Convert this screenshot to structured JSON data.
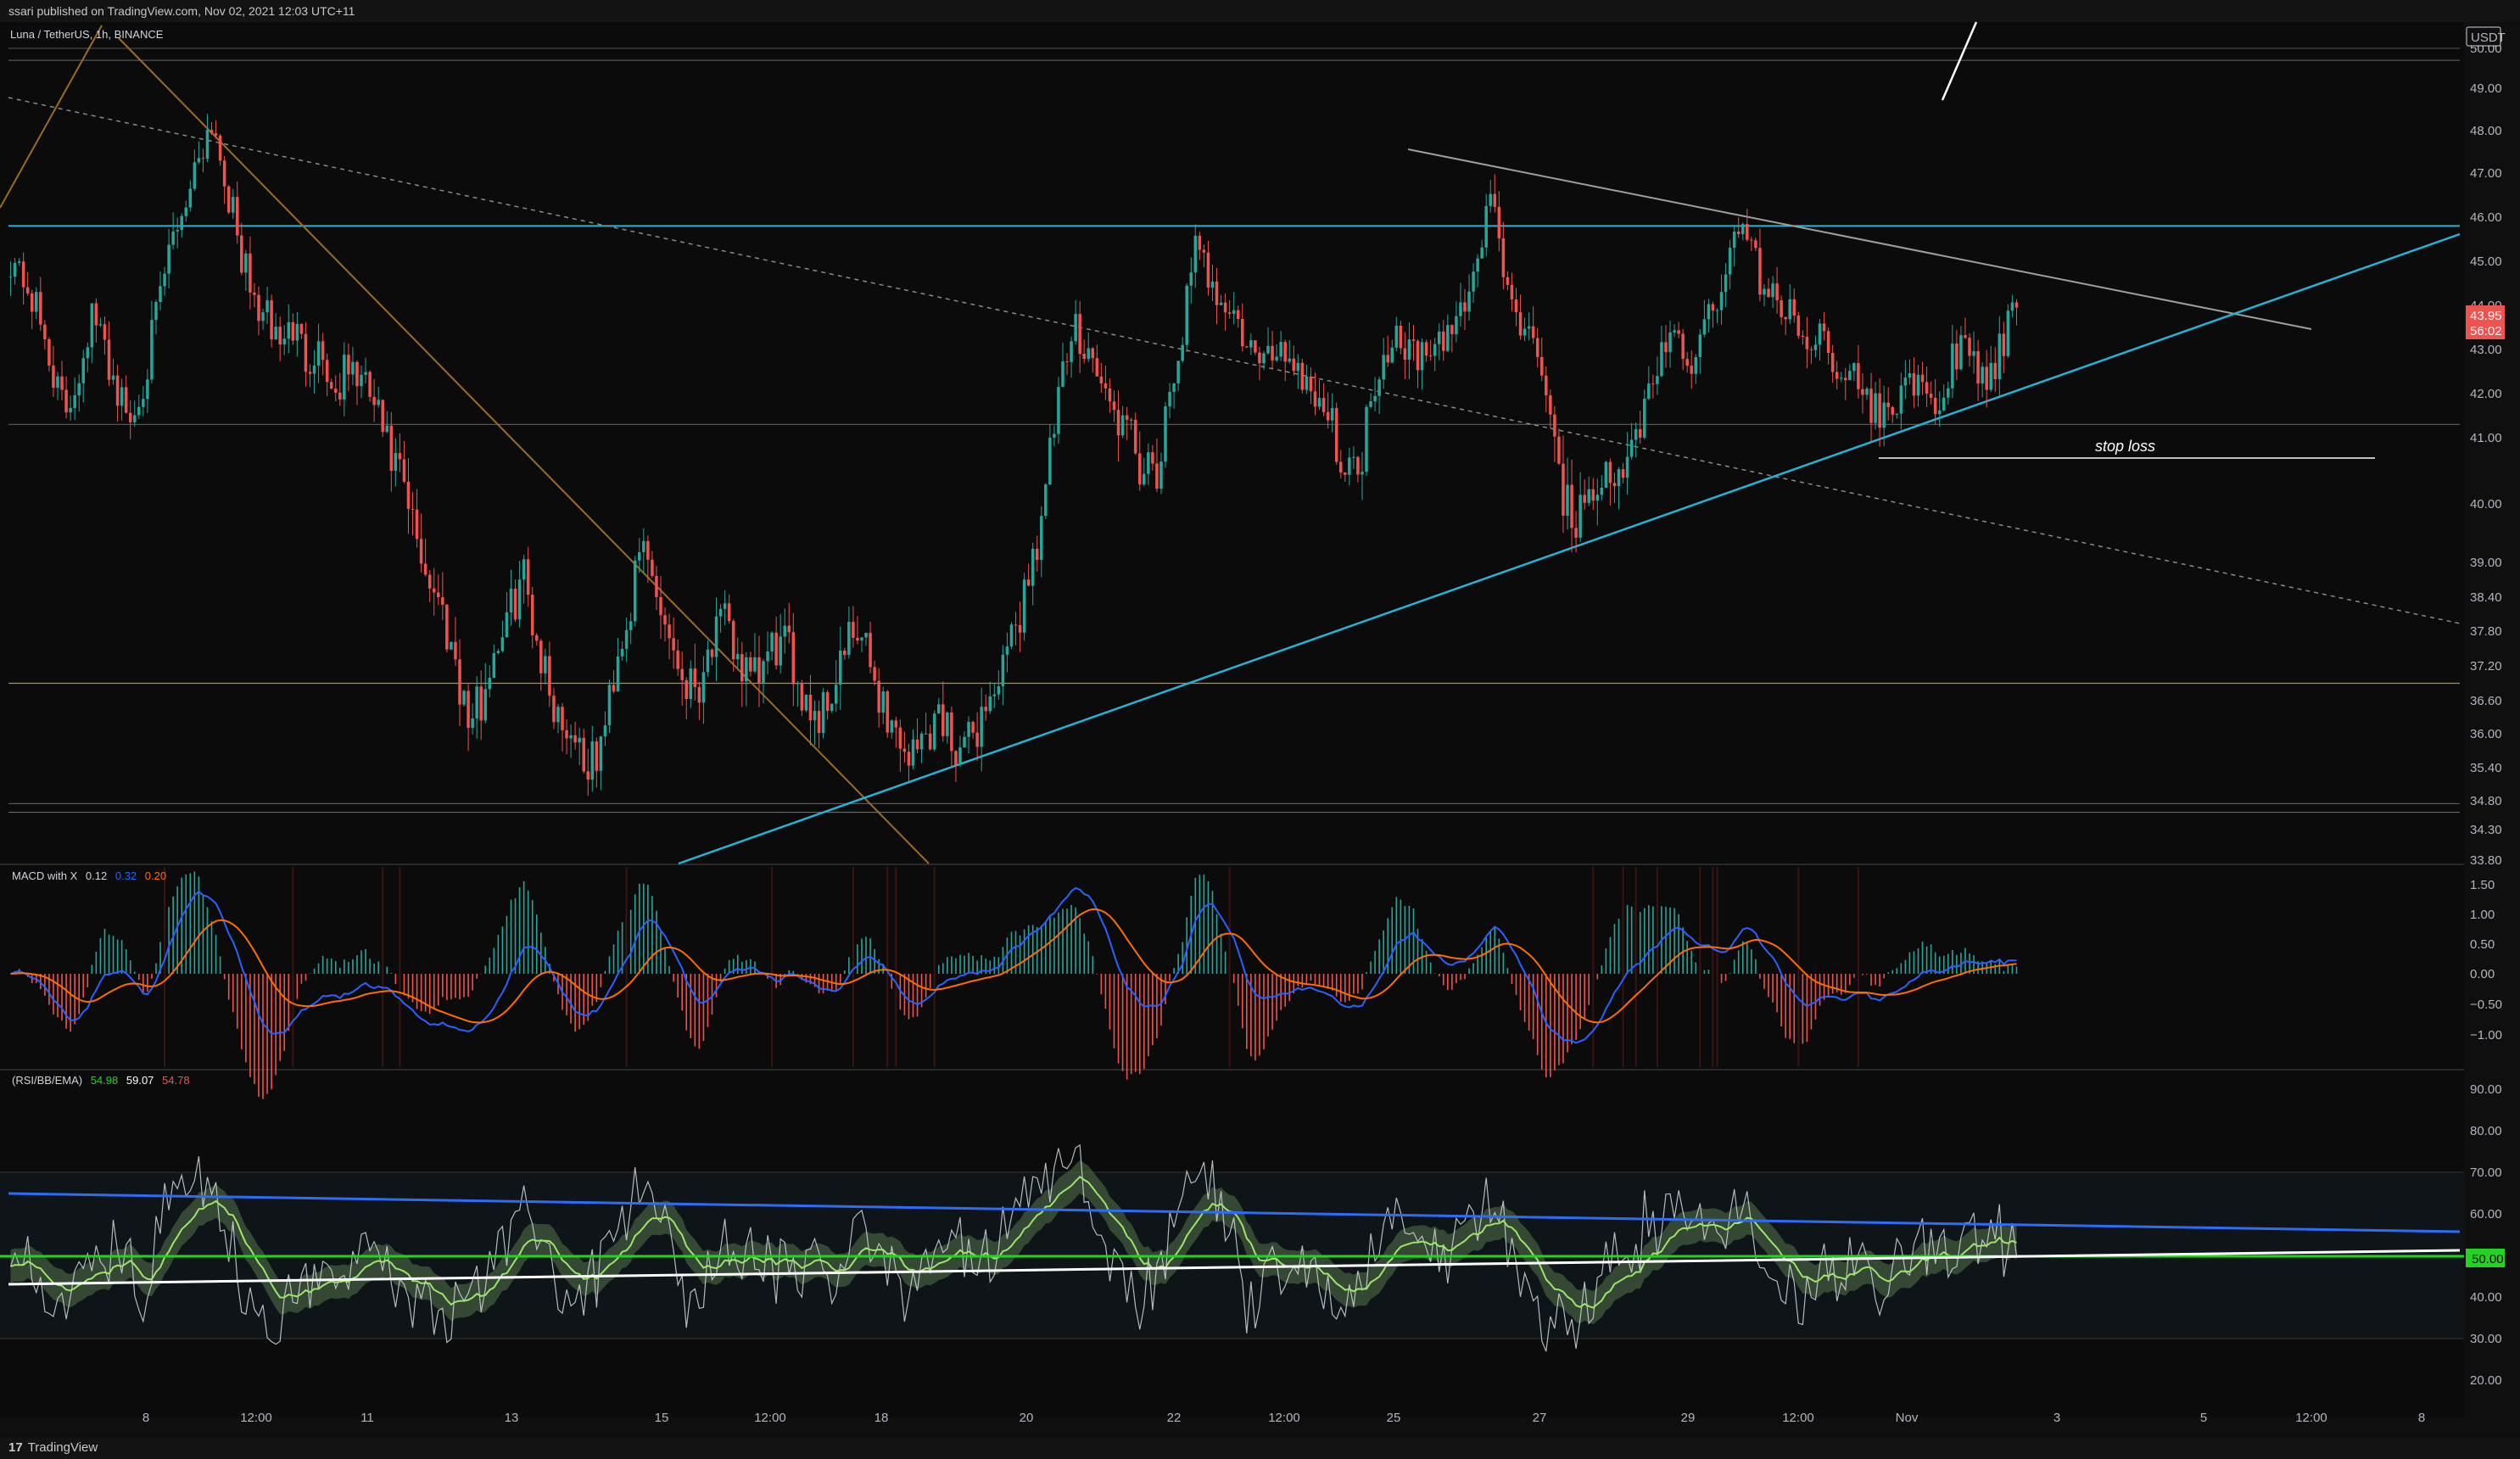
{
  "header": {
    "published_by": "ssari published on TradingView.com, Nov 02, 2021 12:03 UTC+11"
  },
  "footer": {
    "brand": "TradingView",
    "logo_glyph": "17"
  },
  "chart_data": [
    {
      "type": "candlestick",
      "symbol_label": "Luna / TetherUS, 1h, BINANCE",
      "currency": "USDT",
      "price_axis": {
        "ticks": [
          50.0,
          49.0,
          48.0,
          47.0,
          46.0,
          45.0,
          44.0,
          43.0,
          42.0,
          41.0,
          40.0,
          39.0,
          38.4,
          37.8,
          37.2,
          36.6,
          36.0,
          35.4,
          34.8,
          34.3,
          33.8
        ],
        "tick_labels": [
          "50.00",
          "49.00",
          "48.00",
          "47.00",
          "46.00",
          "45.00",
          "44.00",
          "43.00",
          "42.00",
          "41.00",
          "40.00",
          "39.00",
          "38.40",
          "37.80",
          "37.20",
          "36.60",
          "36.00",
          "35.40",
          "34.80",
          "34.30",
          "33.80"
        ]
      },
      "last_price": "43.95",
      "countdown": "56:02",
      "annotation": "stop loss",
      "horizontal_levels": [
        49.7,
        45.8,
        41.3,
        36.9,
        34.75
      ],
      "price_path": [
        45.1,
        44.6,
        43.8,
        42.7,
        41.5,
        42.4,
        43.8,
        43.0,
        42.0,
        41.3,
        42.5,
        44.0,
        45.5,
        46.4,
        47.5,
        48.3,
        46.8,
        45.3,
        44.1,
        43.7,
        43.2,
        43.5,
        42.8,
        43.1,
        41.9,
        42.6,
        42.3,
        41.8,
        40.8,
        40.3,
        39.5,
        38.8,
        38.2,
        37.4,
        36.2,
        36.6,
        37.6,
        38.0,
        38.9,
        37.8,
        36.8,
        36.2,
        36.0,
        35.3,
        35.9,
        37.4,
        38.2,
        39.3,
        38.5,
        37.7,
        37.0,
        36.9,
        37.6,
        37.9,
        37.4,
        36.8,
        37.2,
        37.6,
        37.3,
        36.7,
        36.3,
        36.8,
        37.5,
        37.7,
        37.1,
        36.4,
        35.9,
        35.6,
        36.0,
        36.4,
        35.9,
        35.7,
        36.3,
        36.8,
        37.2,
        38.2,
        39.2,
        40.3,
        42.1,
        43.5,
        43.1,
        42.2,
        41.5,
        41.1,
        40.6,
        40.1,
        41.6,
        43.4,
        45.2,
        44.7,
        44.2,
        43.6,
        43.0,
        42.6,
        43.1,
        42.9,
        42.4,
        42.0,
        41.4,
        40.7,
        40.3,
        41.9,
        43.0,
        43.4,
        43.0,
        42.8,
        42.9,
        43.5,
        44.1,
        45.0,
        46.8,
        44.5,
        43.3,
        43.8,
        41.6,
        40.6,
        39.5,
        40.2,
        40.5,
        40.0,
        40.7,
        41.2,
        42.5,
        43.1,
        43.0,
        42.6,
        43.6,
        44.5,
        45.4,
        45.7,
        44.6,
        44.1,
        43.8,
        43.3,
        43.4,
        43.1,
        42.6,
        42.3,
        41.8,
        41.4,
        41.9,
        42.5,
        41.9,
        41.5,
        42.6,
        43.0,
        42.6,
        42.2,
        43.2,
        43.95
      ]
    },
    {
      "type": "line",
      "indicator": "MACD",
      "legend": {
        "name": "MACD with X",
        "values": [
          "0.12",
          "0.32",
          "0.20"
        ]
      },
      "axis_ticks": [
        1.5,
        1.0,
        0.5,
        0.0,
        -0.5,
        -1.0
      ],
      "tick_labels": [
        "1.50",
        "1.00",
        "0.50",
        "0.00",
        "−0.50",
        "−1.00"
      ]
    },
    {
      "type": "line",
      "indicator": "RSI",
      "legend": {
        "name": "(RSI/BB/EMA)",
        "values": [
          "54.98",
          "59.07",
          "54.78"
        ]
      },
      "axis_ticks": [
        90,
        80,
        70,
        60,
        50,
        40,
        30,
        20
      ],
      "tick_labels": [
        "90.00",
        "80.00",
        "70.00",
        "60.00",
        "50.00",
        "40.00",
        "30.00",
        "20.00"
      ],
      "marker_label": "50.00"
    }
  ],
  "time_axis": {
    "labels": [
      "8",
      "12:00",
      "11",
      "13",
      "15",
      "12:00",
      "18",
      "20",
      "22",
      "12:00",
      "25",
      "27",
      "29",
      "12:00",
      "Nov",
      "3",
      "5",
      "12:00",
      "8"
    ]
  },
  "colors": {
    "up": "#26a69a",
    "down": "#ef5350",
    "level": "#3a3a3a",
    "teal_line": "#26b3d6",
    "orange_line": "#9c6b25",
    "gray_line": "#9e9e9e",
    "macd": "#2962ff",
    "signal": "#ff6d00",
    "rsi_fast": "#cfd8dc",
    "rsi_band": "#4f6b45",
    "rsi_ema": "#9be56b",
    "rsi_blue": "#2f6cf6",
    "rsi_green": "#22d321"
  }
}
